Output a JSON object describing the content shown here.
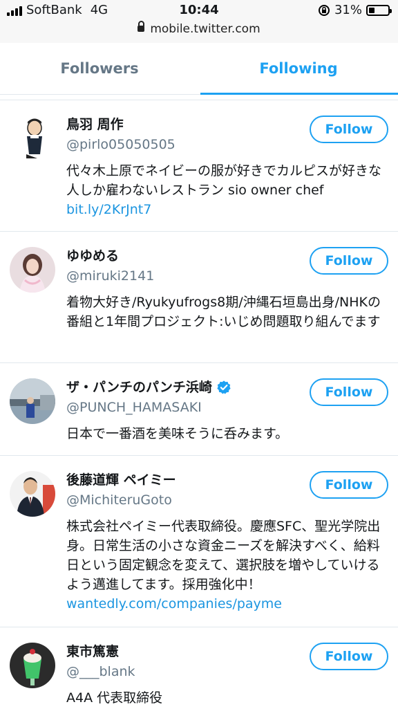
{
  "status_bar": {
    "carrier": "SoftBank",
    "network": "4G",
    "time": "10:44",
    "battery": "31%",
    "battery_level": 0.31,
    "url": "mobile.twitter.com"
  },
  "tabs": [
    {
      "label": "Followers",
      "active": false
    },
    {
      "label": "Following",
      "active": true
    }
  ],
  "accent_color": "#1da1f2",
  "users": [
    {
      "name": "鳥羽 周作",
      "handle": "@pirlo05050505",
      "bio": "代々木上原でネイビーの服が好きでカルピスが好きな人しか雇わないレストラン sio owner chef",
      "link": "bit.ly/2KrJnt7",
      "verified": false,
      "follow_label": "Follow"
    },
    {
      "name": "ゆゆめる",
      "handle": "@miruki2141",
      "bio": "着物大好き/Ryukyufrogs8期/沖縄石垣島出身/NHKの番組と1年間プロジェクト:いじめ問題取り組んでます",
      "link": "",
      "verified": false,
      "follow_label": "Follow"
    },
    {
      "name": "ザ・パンチのパンチ浜崎",
      "handle": "@PUNCH_HAMASAKI",
      "bio": "日本で一番酒を美味そうに呑みます。",
      "link": "",
      "verified": true,
      "follow_label": "Follow"
    },
    {
      "name": "後藤道輝 ペイミー",
      "handle": "@MichiteruGoto",
      "bio": "株式会社ペイミー代表取締役。慶應SFC、聖光学院出身。日常生活の小さな資金ニーズを解決すべく、給料日という固定観念を変えて、選択肢を増やしていけるよう邁進してます。採用強化中！",
      "link": "wantedly.com/companies/payme",
      "verified": false,
      "follow_label": "Follow"
    },
    {
      "name": "東市篤憲",
      "handle": "@___blank",
      "bio": "A4A 代表取締役",
      "link": "",
      "verified": false,
      "follow_label": "Follow"
    }
  ]
}
